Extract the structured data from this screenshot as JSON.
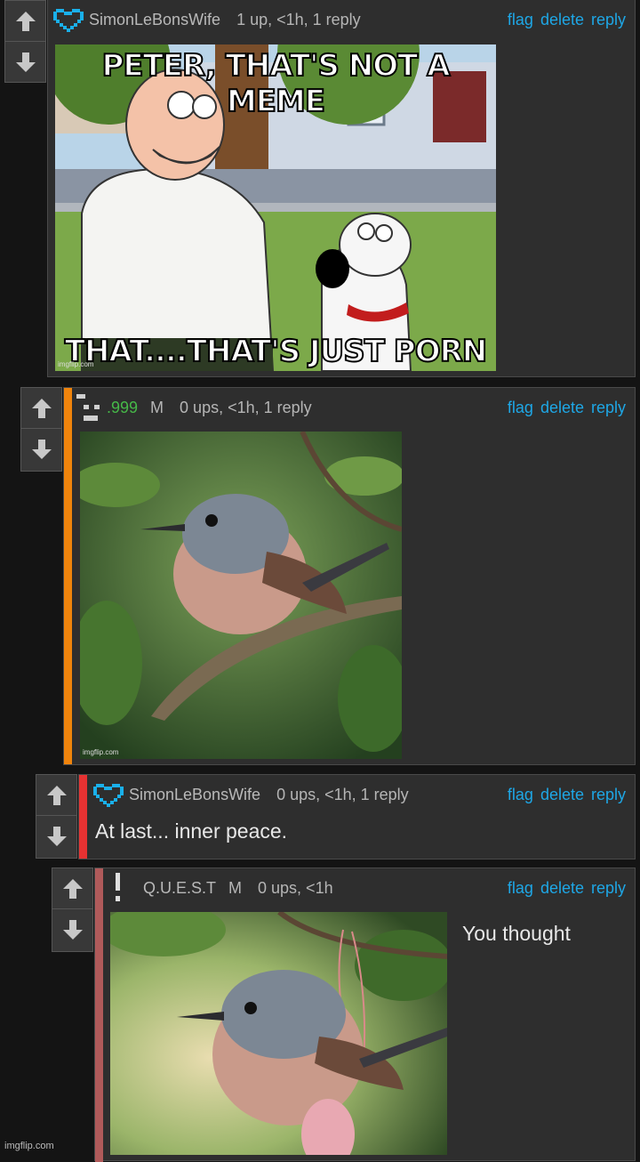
{
  "comments": [
    {
      "username": "SimonLeBonsWife",
      "meta": "1 up, <1h, 1 reply",
      "actions": {
        "flag": "flag",
        "delete": "delete",
        "reply": "reply"
      },
      "image": {
        "top_text": "PETER, THAT'S NOT A MEME",
        "bottom_text": "THAT....THAT'S JUST PORN",
        "watermark": "imgflip.com"
      }
    },
    {
      "username": ".999",
      "badge": "M",
      "meta": "0 ups, <1h, 1 reply",
      "actions": {
        "flag": "flag",
        "delete": "delete",
        "reply": "reply"
      },
      "image": {
        "watermark": "imgflip.com"
      }
    },
    {
      "username": "SimonLeBonsWife",
      "meta": "0 ups, <1h, 1 reply",
      "actions": {
        "flag": "flag",
        "delete": "delete",
        "reply": "reply"
      },
      "text": "At last... inner peace."
    },
    {
      "username": "Q.U.E.S.T",
      "badge": "M",
      "meta": "0 ups, <1h",
      "actions": {
        "flag": "flag",
        "delete": "delete",
        "reply": "reply"
      },
      "text": "You thought"
    }
  ],
  "page_watermark": "imgflip.com",
  "colors": {
    "link": "#1ea7e6",
    "thread_bar_2": "#f0840c",
    "thread_bar_3": "#e63232",
    "thread_bar_4": "#b05a5a",
    "username_green": "#46b848"
  }
}
